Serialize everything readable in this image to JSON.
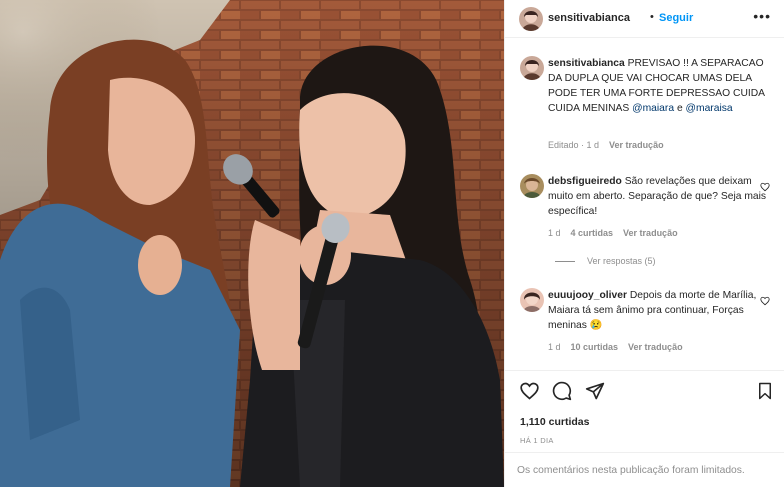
{
  "post": {
    "author": "sensitivabianca",
    "follow_label": "Seguir",
    "header_dot": "•",
    "more_label": "•••",
    "photo_alt_icon": "photo-two-women-singing"
  },
  "caption": {
    "username": "sensitivabianca",
    "text": "PREVISAO !! A SEPARACAO DA DUPLA QUE VAI CHOCAR UMAS DELA PODE TER UMA FORTE DEPRESSAO CUIDA CUIDA MENINAS",
    "mention1": "@maiara",
    "joiner": "e",
    "mention2": "@maraisa",
    "edited": "Editado · 1 d",
    "translate": "Ver tradução"
  },
  "comments": [
    {
      "username": "debsfigueiredo",
      "text": "São revelações que deixam muito em aberto. Separação de que? Seja mais específica!",
      "time": "1 d",
      "likes": "4 curtidas",
      "translate": "Ver tradução",
      "view_replies": "Ver respostas (5)"
    },
    {
      "username": "euuujooy_oliver",
      "text": "Depois da morte de Marília, Maiara tá sem ânimo pra continuar, Forças meninas",
      "emoji": "😢",
      "time": "1 d",
      "likes": "10 curtidas",
      "translate": "Ver tradução"
    }
  ],
  "footer": {
    "likes": "1,110 curtidas",
    "time": "HÁ 1 DIA",
    "limited": "Os comentários nesta publicação foram limitados."
  },
  "icons": {
    "like": "heart-icon",
    "comment": "comment-icon",
    "share": "send-icon",
    "save": "bookmark-icon"
  },
  "colors": {
    "link": "#0095f6",
    "mention": "#00376b",
    "muted": "#8e8e8e",
    "text": "#262626",
    "divider": "#efefef"
  }
}
